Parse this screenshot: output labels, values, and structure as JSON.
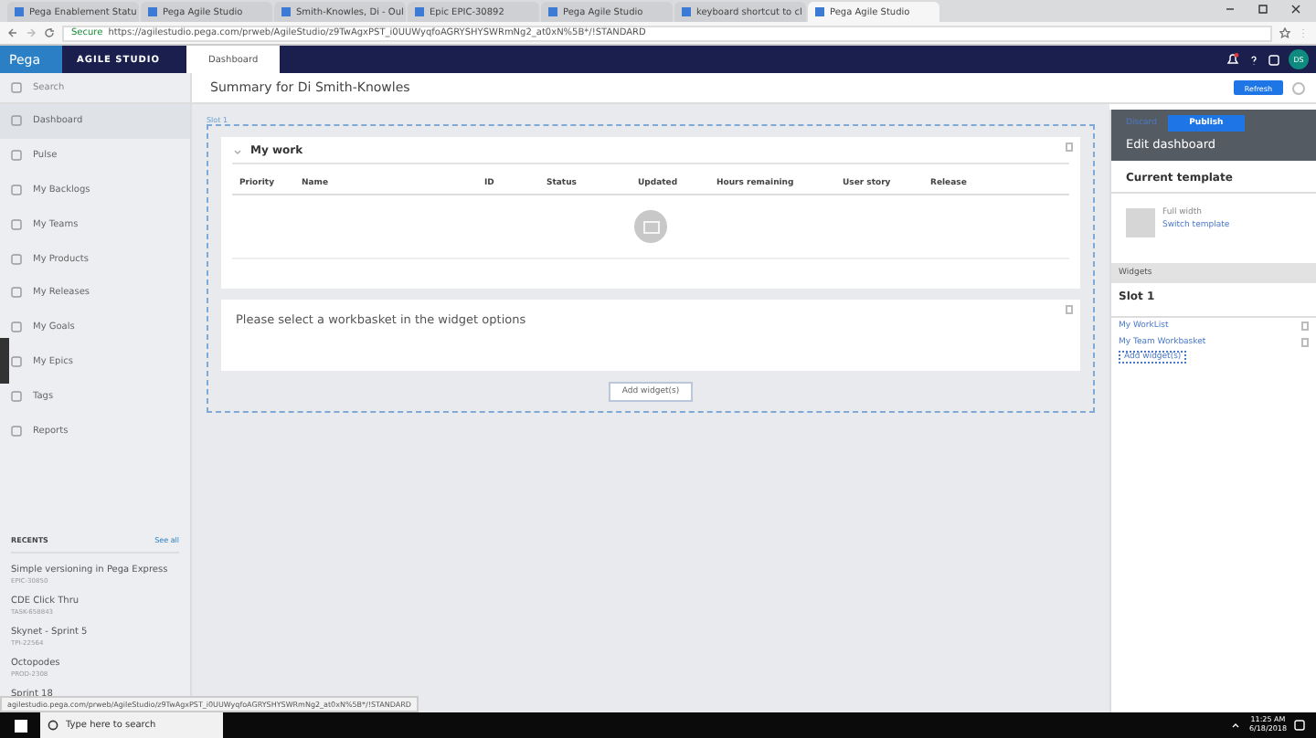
{
  "browser": {
    "tabs": [
      {
        "title": "Pega Enablement Statu",
        "selected": false
      },
      {
        "title": "Pega Agile Studio",
        "selected": false
      },
      {
        "title": "Smith-Knowles, Di - Oul",
        "selected": false
      },
      {
        "title": "Epic EPIC-30892",
        "selected": false
      },
      {
        "title": "Pega Agile Studio",
        "selected": false
      },
      {
        "title": "keyboard shortcut to cl",
        "selected": false
      },
      {
        "title": "Pega Agile Studio",
        "selected": true
      }
    ],
    "secure_label": "Secure",
    "url": "https://agilestudio.pega.com/prweb/AgileStudio/z9TwAgxPST_i0UUWyqfoAGRYSHYSWRmNg2_at0xN%5B*/!STANDARD"
  },
  "app_header": {
    "brand": "Pega",
    "product": "AGILE STUDIO",
    "tab": "Dashboard",
    "avatar": "DS"
  },
  "sidebar": {
    "search_placeholder": "Search",
    "items": [
      {
        "label": "Dashboard",
        "selected": true
      },
      {
        "label": "Pulse",
        "selected": false
      },
      {
        "label": "My Backlogs",
        "selected": false
      },
      {
        "label": "My Teams",
        "selected": false
      },
      {
        "label": "My Products",
        "selected": false
      },
      {
        "label": "My Releases",
        "selected": false
      },
      {
        "label": "My Goals",
        "selected": false
      },
      {
        "label": "My Epics",
        "selected": false
      },
      {
        "label": "Tags",
        "selected": false
      },
      {
        "label": "Reports",
        "selected": false
      }
    ],
    "recents_title": "RECENTS",
    "see_all": "See all",
    "recents": [
      {
        "title": "Simple versioning in Pega Express",
        "id": "EPIC-30850"
      },
      {
        "title": "CDE Click Thru",
        "id": "TASK-658843"
      },
      {
        "title": "Skynet - Sprint 5",
        "id": "TPI-22564"
      },
      {
        "title": "Octopodes",
        "id": "PROD-2308"
      },
      {
        "title": "Sprint 18"
      }
    ]
  },
  "page": {
    "title": "Summary for Di Smith-Knowles",
    "refresh": "Refresh",
    "slot_label": "Slot 1",
    "my_work": {
      "title": "My work",
      "columns": [
        "Priority",
        "Name",
        "ID",
        "Status",
        "Updated",
        "Hours remaining",
        "User story",
        "Release"
      ]
    },
    "workbasket_message": "Please select a workbasket in the widget options",
    "add_widget": "Add widget(s)"
  },
  "edit_panel": {
    "discard": "Discard",
    "publish": "Publish",
    "title": "Edit dashboard",
    "template_heading": "Current template",
    "template_name": "Full width",
    "switch_template": "Switch template",
    "widgets_heading": "Widgets",
    "slot": "Slot 1",
    "widgets": [
      "My WorkList",
      "My Team Workbasket"
    ],
    "add_widget": "Add widget(s)"
  },
  "status_url": "agilestudio.pega.com/prweb/AgileStudio/z9TwAgxPST_i0UUWyqfoAGRYSHYSWRmNg2_at0xN%5B*/!STANDARD",
  "taskbar": {
    "search_placeholder": "Type here to search",
    "time": "11:25 AM",
    "date": "6/18/2018"
  }
}
